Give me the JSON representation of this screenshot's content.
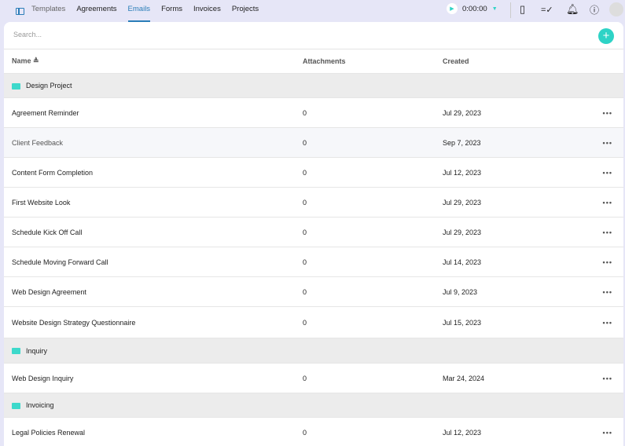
{
  "tabs": [
    "Templates",
    "Agreements",
    "Emails",
    "Forms",
    "Invoices",
    "Projects"
  ],
  "active_tab": "Emails",
  "timer": "0:00:00",
  "search": {
    "placeholder": "Search..."
  },
  "columns": {
    "name": "Name ≜",
    "attachments": "Attachments",
    "created": "Created"
  },
  "groups": [
    {
      "folder": "Design Project",
      "rows": [
        {
          "name": "Agreement Reminder",
          "attachments": "0",
          "created": "Jul 29, 2023"
        },
        {
          "name": "Client Feedback",
          "attachments": "0",
          "created": "Sep 7, 2023"
        },
        {
          "name": "Content Form Completion",
          "attachments": "0",
          "created": "Jul 12, 2023"
        },
        {
          "name": "First Website Look",
          "attachments": "0",
          "created": "Jul 29, 2023"
        },
        {
          "name": "Schedule Kick Off Call",
          "attachments": "0",
          "created": "Jul 29, 2023"
        },
        {
          "name": "Schedule Moving Forward Call",
          "attachments": "0",
          "created": "Jul 14, 2023"
        },
        {
          "name": "Web Design Agreement",
          "attachments": "0",
          "created": "Jul 9, 2023"
        },
        {
          "name": "Website Design Strategy Questionnaire",
          "attachments": "0",
          "created": "Jul 15, 2023"
        }
      ]
    },
    {
      "folder": "Inquiry",
      "rows": [
        {
          "name": "Web Design Inquiry",
          "attachments": "0",
          "created": "Mar 24, 2024"
        }
      ]
    },
    {
      "folder": "Invoicing",
      "rows": [
        {
          "name": "Legal Policies Renewal",
          "attachments": "0",
          "created": "Jul 12, 2023"
        }
      ]
    }
  ],
  "more": "•••"
}
